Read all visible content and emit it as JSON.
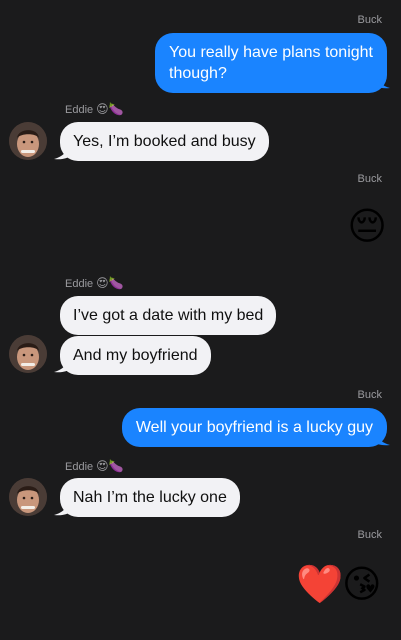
{
  "messages": [
    {
      "sender": "Buck",
      "text": "You really have plans tonight though?"
    },
    {
      "sender": "Eddie",
      "sender_emoji": "😍🍆",
      "text": "Yes, I’m booked and busy"
    },
    {
      "sender": "Buck",
      "text": "😔"
    },
    {
      "sender": "Eddie",
      "sender_emoji": "😍🍆",
      "text": "I’ve got a date with my bed"
    },
    {
      "text": "And my boyfriend"
    },
    {
      "sender": "Buck",
      "text": "Well your boyfriend is a lucky guy"
    },
    {
      "sender": "Eddie",
      "sender_emoji": "😍🍆",
      "text": "Nah I’m the lucky one"
    },
    {
      "sender": "Buck",
      "text": "❤️ 😘"
    }
  ],
  "big_emoji": {
    "sad": "😔",
    "heart": "❤️",
    "kiss": "😘"
  },
  "colors": {
    "background": "#1b1b1c",
    "outgoing_bubble": "#1a84ff",
    "incoming_bubble": "#f2f2f5",
    "sender_name": "#9a9a9e"
  }
}
